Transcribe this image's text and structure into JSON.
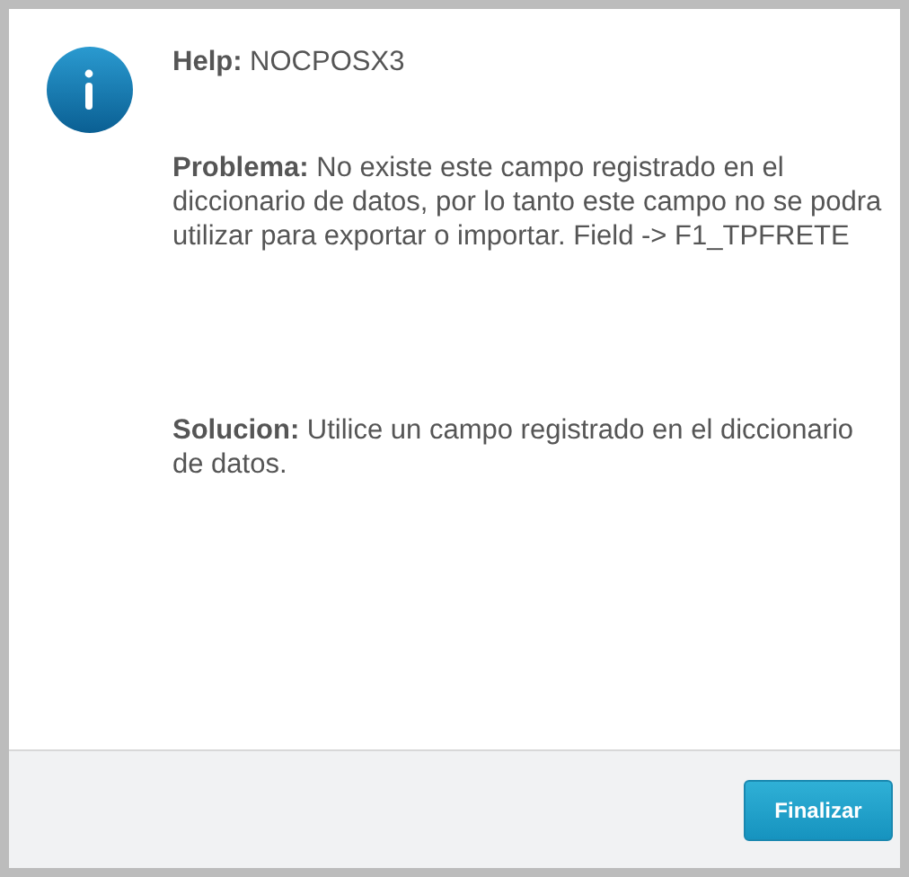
{
  "help": "**Help:** NOCPOSX3",
  "problem": "**Problema:** No existe este campo registrado en el diccionario de datos, por lo tanto este campo no se podra utilizar para exportar o importar. Field -> F1_TPFRETE",
  "solution": "**Solucion:** Utilice un campo registrado en el diccionario de datos.",
  "buttons": [
    "Finalizar"
  ]
}
